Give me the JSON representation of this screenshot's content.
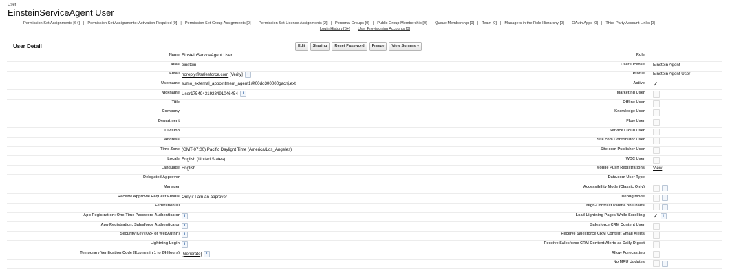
{
  "header": {
    "type": "User",
    "title": "EinsteinServiceAgent User"
  },
  "related_links": {
    "line1": [
      "Permission Set Assignments [6+]",
      "Permission Set Assignments: Activation Required [0]",
      "Permission Set Group Assignments [0]",
      "Permission Set License Assignments [2]",
      "Personal Groups [0]",
      "Public Group Membership [0]",
      "Queue Membership [0]",
      "Team [0]",
      "Managers in the Role Hierarchy [0]",
      "OAuth Apps [0]",
      "Third-Party Account Links [0]"
    ],
    "line2": [
      "Login History [6+]",
      "User Provisioning Accounts [0]"
    ]
  },
  "section": {
    "title": "User Detail"
  },
  "buttons": [
    "Edit",
    "Sharing",
    "Reset Password",
    "Freeze",
    "View Summary"
  ],
  "left_fields": [
    {
      "label": "Name",
      "value": "EinsteinServiceAgent User"
    },
    {
      "label": "Alias",
      "value": "einstein"
    },
    {
      "label": "Email",
      "value": "noreply@salesforce.com",
      "extra": "[Verify]",
      "info": true
    },
    {
      "label": "Username",
      "value": "sumo_external_appointment_agent1@00do300000gacnj.ext"
    },
    {
      "label": "Nickname",
      "value": "User17549431928491046454",
      "info": true
    },
    {
      "label": "Title",
      "value": ""
    },
    {
      "label": "Company",
      "value": ""
    },
    {
      "label": "Department",
      "value": ""
    },
    {
      "label": "Division",
      "value": ""
    },
    {
      "label": "Address",
      "value": ""
    },
    {
      "label": "Time Zone",
      "value": "(GMT-07:00) Pacific Daylight Time (America/Los_Angeles)"
    },
    {
      "label": "Locale",
      "value": "English (United States)"
    },
    {
      "label": "Language",
      "value": "English"
    },
    {
      "label": "Delegated Approver",
      "value": ""
    },
    {
      "label": "Manager",
      "value": ""
    },
    {
      "label": "Receive Approval Request Emails",
      "value": "Only if I am an approver"
    },
    {
      "label": "Federation ID",
      "value": ""
    },
    {
      "label": "App Registration: One-Time Password Authenticator",
      "value": "",
      "info": true
    },
    {
      "label": "App Registration: Salesforce Authenticator",
      "value": "",
      "info": true
    },
    {
      "label": "Security Key (U2F or WebAuthn)",
      "value": "",
      "info": true
    },
    {
      "label": "Lightning Login",
      "value": "",
      "info": true
    },
    {
      "label": "Temporary Verification Code (Expires in 1 to 24 Hours)",
      "value": "[Generate]",
      "info": true
    }
  ],
  "right_fields": [
    {
      "label": "Role",
      "kind": "text",
      "value": ""
    },
    {
      "label": "User License",
      "kind": "text",
      "value": "Einstein Agent"
    },
    {
      "label": "Profile",
      "kind": "link",
      "value": "Einstein Agent User"
    },
    {
      "label": "Active",
      "kind": "check",
      "checked": true
    },
    {
      "label": "Marketing User",
      "kind": "check",
      "checked": false
    },
    {
      "label": "Offline User",
      "kind": "check",
      "checked": false
    },
    {
      "label": "Knowledge User",
      "kind": "check",
      "checked": false
    },
    {
      "label": "Flow User",
      "kind": "check",
      "checked": false
    },
    {
      "label": "Service Cloud User",
      "kind": "check",
      "checked": false
    },
    {
      "label": "Site.com Contributor User",
      "kind": "check",
      "checked": false
    },
    {
      "label": "Site.com Publisher User",
      "kind": "check",
      "checked": false
    },
    {
      "label": "WDC User",
      "kind": "check",
      "checked": false
    },
    {
      "label": "Mobile Push Registrations",
      "kind": "link",
      "value": "View"
    },
    {
      "label": "Data.com User Type",
      "kind": "info"
    },
    {
      "label": "Accessibility Mode (Classic Only)",
      "kind": "check",
      "checked": false,
      "info": true
    },
    {
      "label": "Debug Mode",
      "kind": "check",
      "checked": false,
      "info": true
    },
    {
      "label": "High-Contrast Palette on Charts",
      "kind": "check",
      "checked": false,
      "info": true
    },
    {
      "label": "Load Lightning Pages While Scrolling",
      "kind": "check",
      "checked": true,
      "info": true
    },
    {
      "label": "Salesforce CRM Content User",
      "kind": "check",
      "checked": false
    },
    {
      "label": "Receive Salesforce CRM Content Email Alerts",
      "kind": "check",
      "checked": false
    },
    {
      "label": "Receive Salesforce CRM Content Alerts as Daily Digest",
      "kind": "check",
      "checked": false
    },
    {
      "label": "Allow Forecasting",
      "kind": "check",
      "checked": false
    },
    {
      "label": "No MRU Updates",
      "kind": "check",
      "checked": false,
      "info": true
    }
  ],
  "icons": {
    "info": "i",
    "checkmark": "✓"
  }
}
